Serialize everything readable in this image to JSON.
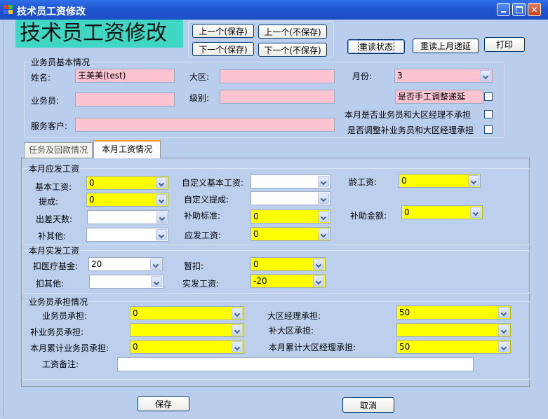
{
  "window": {
    "title": "技术员工资修改"
  },
  "header": {
    "big_title": "技术员工资修改"
  },
  "nav": {
    "prev_save": "上一个(保存)",
    "prev_nosave": "上一个(不保存)",
    "next_save": "下一个(保存)",
    "next_nosave": "下一个(不保存)"
  },
  "toolbar": {
    "reread_status": "重读状态",
    "reread_last_month": "重读上月递延",
    "print": "打印"
  },
  "basic": {
    "legend": "业务员基本情况",
    "name_label": "姓名:",
    "name_value": "王美美(test)",
    "region_label": "大区:",
    "region_value": "",
    "month_label": "月份:",
    "month_value": "3",
    "salesman_label": "业务员:",
    "salesman_value": "",
    "level_label": "级别:",
    "level_value": "",
    "manual_defer_label": "是否手工调整递延",
    "customer_label": "服务客户:",
    "customer_value": "",
    "not_bear_label": "本月是否业务员和大区经理不承担",
    "adjust_label": "是否调整补业务员和大区经理承担"
  },
  "tabs": [
    {
      "label": "任务及回款情况"
    },
    {
      "label": "本月工资情况"
    }
  ],
  "payable": {
    "legend": "本月应发工资",
    "base_label": "基本工资:",
    "base_value": "0",
    "custom_base_label": "自定义基本工资:",
    "custom_base_value": "",
    "seniority_label": "龄工资:",
    "seniority_value": "0",
    "commission_label": "提成:",
    "commission_value": "0",
    "custom_commission_label": "自定义提成:",
    "custom_commission_value": "",
    "trip_days_label": "出差天数:",
    "trip_days_value": "",
    "subsidy_std_label": "补助标准:",
    "subsidy_std_value": "0",
    "subsidy_amt_label": "补助金额:",
    "subsidy_amt_value": "0",
    "other_supp_label": "补其他:",
    "other_supp_value": "",
    "payable_label": "应发工资:",
    "payable_value": "0"
  },
  "actual": {
    "legend": "本月实发工资",
    "medical_label": "扣医疗基金:",
    "medical_value": "20",
    "withhold_label": "暂扣:",
    "withhold_value": "0",
    "other_deduct_label": "扣其他:",
    "other_deduct_value": "",
    "actual_label": "实发工资:",
    "actual_value": "-20"
  },
  "bear": {
    "legend": "业务员承担情况",
    "salesman_bear_label": "业务员承担:",
    "salesman_bear_value": "0",
    "manager_bear_label": "大区经理承担:",
    "manager_bear_value": "50",
    "supp_salesman_label": "补业务员承担:",
    "supp_salesman_value": "",
    "supp_region_label": "补大区承担:",
    "supp_region_value": "",
    "cum_salesman_label": "本月累计业务员承担:",
    "cum_salesman_value": "0",
    "cum_manager_label": "本月累计大区经理承担:",
    "cum_manager_value": "50",
    "remark_label": "工资备注:",
    "remark_value": ""
  },
  "footer": {
    "save": "保存",
    "cancel": "取消"
  }
}
